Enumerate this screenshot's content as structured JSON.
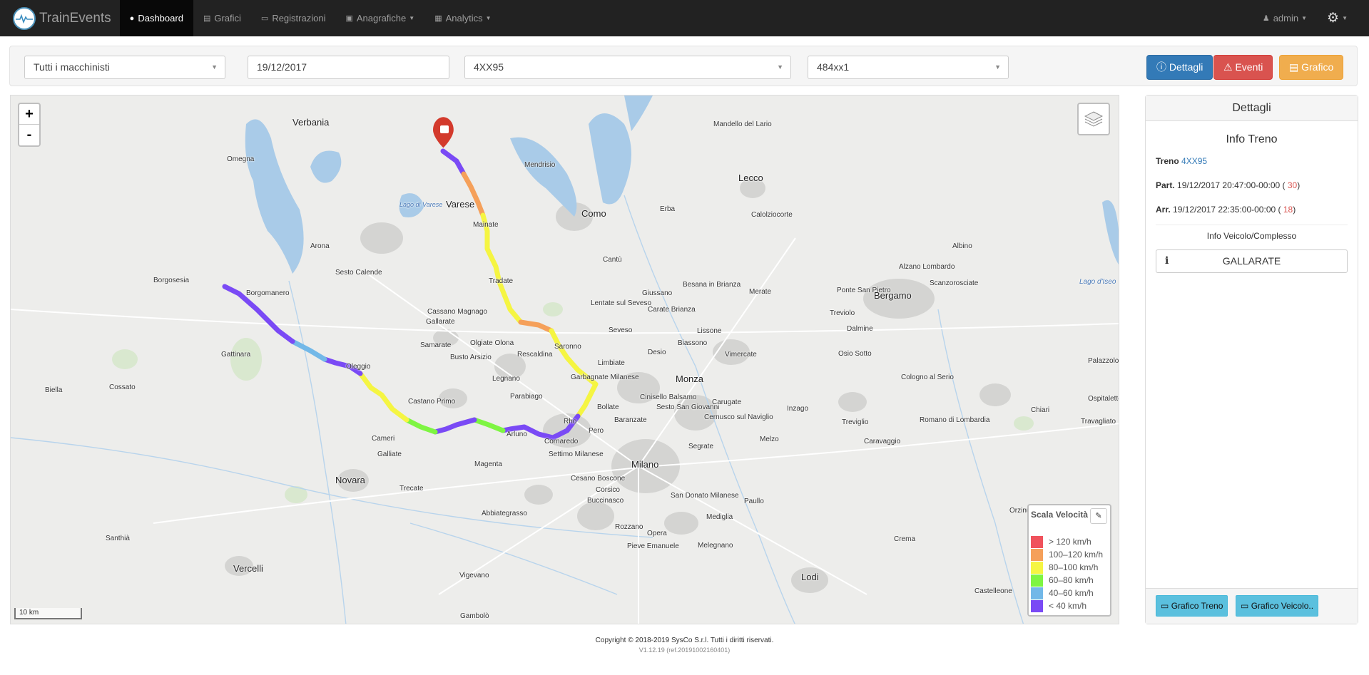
{
  "navbar": {
    "brand": "TrainEvents",
    "items": [
      {
        "label": "Dashboard",
        "icon": "map-marker-icon"
      },
      {
        "label": "Grafici",
        "icon": "chart-icon"
      },
      {
        "label": "Registrazioni",
        "icon": "file-icon"
      },
      {
        "label": "Anagrafiche",
        "icon": "book-icon"
      },
      {
        "label": "Analytics",
        "icon": "grid-icon"
      }
    ],
    "user": "admin"
  },
  "filters": {
    "driver": "Tutti i macchinisti",
    "date": "19/12/2017",
    "train": "4XX95",
    "vehicle": "484xx1"
  },
  "actions": {
    "details": "Dettagli",
    "events": "Eventi",
    "chart": "Grafico"
  },
  "map": {
    "zoom_in": "+",
    "zoom_out": "-",
    "scale": "10 km",
    "places": [
      "Verbania",
      "Mandello del Lario",
      "Omegna",
      "Varese",
      "Lago di Varese",
      "Mendrisio",
      "Como",
      "Erba",
      "Lecco",
      "Calolziocorte",
      "Mainate",
      "Arona",
      "Cantù",
      "Albino",
      "Sesto Calende",
      "Tradate",
      "Giussano",
      "Besana in Brianza",
      "Borgomanero",
      "Borgosesia",
      "Merate",
      "Ponte San Pietro",
      "Bergamo",
      "Alzano Lombardo",
      "Scanzorosciate",
      "Lentate sul Seveso",
      "Carate Brianza",
      "Cassano Magnago",
      "Gallarate",
      "Treviolo",
      "Lago d'Iseo",
      "Samarate",
      "Olgiate Olona",
      "Saronno",
      "Seveso",
      "Lissone",
      "Desio",
      "Biassono",
      "Dalmine",
      "Gattinara",
      "Busto Arsizio",
      "Rescaldina",
      "Limbiate",
      "Vimercate",
      "Osio Sotto",
      "Palazzolo sull'Oglio",
      "Oleggio",
      "Legnano",
      "Garbagnate Milanese",
      "Monza",
      "Cologno al Serio",
      "Biella",
      "Cossato",
      "Castano Primo",
      "Parabiago",
      "Cinisello Balsamo",
      "Sesto San Giovanni",
      "Carugate",
      "Inzago",
      "Chiari",
      "Ospitaletto",
      "Bollate",
      "Baranzate",
      "Cernusco sul Naviglio",
      "Treviglio",
      "Romano di Lombardia",
      "Travagliato",
      "Rho",
      "Pero",
      "Arluno",
      "Cameri",
      "Galliate",
      "Cornaredo",
      "Segrate",
      "Melzo",
      "Caravaggio",
      "Settimo Milanese",
      "Novara",
      "Magenta",
      "Milano",
      "Trecate",
      "Cesano Boscone",
      "Corsico",
      "San Donato Milanese",
      "Paullo",
      "Buccinasco",
      "Abbiategrasso",
      "Mediglia",
      "Orzinuovi",
      "Rozzano",
      "Opera",
      "Santhià",
      "Pieve Emanuele",
      "Melegnano",
      "Crema",
      "Vercelli",
      "Vigevano",
      "Lodi",
      "Castelleone",
      "Gambolò"
    ],
    "legend": {
      "title": "Scala Velocità",
      "items": [
        {
          "label": "> 120 km/h",
          "color": "#f0525c"
        },
        {
          "label": "100–120 km/h",
          "color": "#f5a05a"
        },
        {
          "label": "80–100 km/h",
          "color": "#f5f542"
        },
        {
          "label": "60–80 km/h",
          "color": "#7ef542"
        },
        {
          "label": "40–60 km/h",
          "color": "#72b8e8"
        },
        {
          "label": "< 40 km/h",
          "color": "#7a4af5"
        }
      ]
    }
  },
  "panel": {
    "title": "Dettagli",
    "subtitle": "Info Treno",
    "train_label": "Treno",
    "train_value": "4XX95",
    "dep_label": "Part.",
    "dep_value": "19/12/2017 20:47:00-00:00",
    "dep_delay": "30",
    "arr_label": "Arr.",
    "arr_value": "19/12/2017 22:35:00-00:00",
    "arr_delay": "18",
    "vehicle_title": "Info Veicolo/Complesso",
    "vehicle_name": "GALLARATE",
    "btn_train_chart": "Grafico Treno",
    "btn_vehicle_chart": "Grafico Veicolo.."
  },
  "footer": {
    "copyright": "Copyright © 2018-2019 SysCo S.r.l. Tutti i diritti riservati.",
    "version": "V1.12.19 (ref.20191002160401)"
  }
}
